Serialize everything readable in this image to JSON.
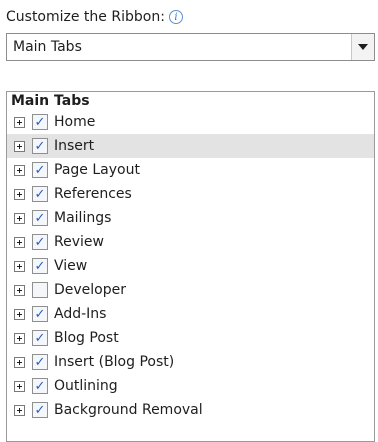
{
  "customize": {
    "label": "Customize the Ribbon:",
    "info_icon_glyph": "i"
  },
  "dropdown": {
    "selected": "Main Tabs"
  },
  "tree": {
    "header": "Main Tabs",
    "items": [
      {
        "label": "Home",
        "checked": true
      },
      {
        "label": "Insert",
        "checked": true,
        "selected": true
      },
      {
        "label": "Page Layout",
        "checked": true
      },
      {
        "label": "References",
        "checked": true
      },
      {
        "label": "Mailings",
        "checked": true
      },
      {
        "label": "Review",
        "checked": true
      },
      {
        "label": "View",
        "checked": true
      },
      {
        "label": "Developer",
        "checked": false
      },
      {
        "label": "Add-Ins",
        "checked": true
      },
      {
        "label": "Blog Post",
        "checked": true
      },
      {
        "label": "Insert (Blog Post)",
        "checked": true
      },
      {
        "label": "Outlining",
        "checked": true
      },
      {
        "label": "Background Removal",
        "checked": true
      }
    ]
  },
  "colors": {
    "checkmark": "#2c5fb8",
    "selected_row": "#e3e3e3",
    "info_icon": "#3a73c5"
  }
}
